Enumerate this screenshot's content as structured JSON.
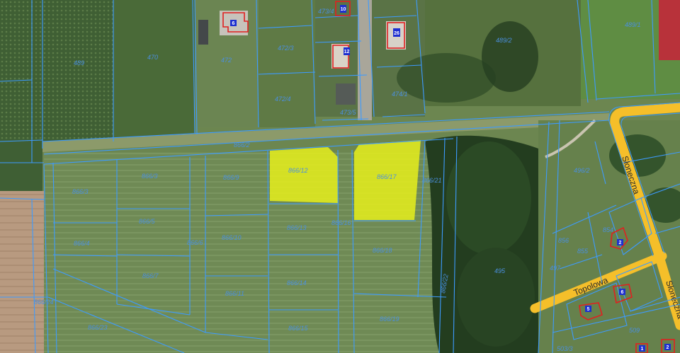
{
  "map": {
    "colors": {
      "parcel_line": "#3d9bff",
      "highlight": "#e6ee1c",
      "road": "#f5bf2a",
      "building_outline": "#e02020",
      "house_marker": "#1e2fd0",
      "parcel_label": "#4a8fe0"
    },
    "parcel_labels": {
      "p489": "489",
      "p470": "470",
      "p472": "472",
      "p472_3": "472/3",
      "p472_4": "472/4",
      "p473_4": "473/4",
      "p473_5": "473/5",
      "p474_1": "474/1",
      "p474_2": "474/2",
      "p489_2": "489/2",
      "p489_1": "489/1",
      "p866_2": "866/2",
      "p866_3a": "866/3",
      "p866_3b": "866/3",
      "p866_9": "866/9",
      "p866_12": "866/12",
      "p866_17": "866/17",
      "p866_21": "866/21",
      "p866_5": "866/5",
      "p866_4": "866/4",
      "p866_6": "866/6",
      "p866_10": "866/10",
      "p866_13": "866/13",
      "p866_16": "866/16",
      "p866_18": "866/18",
      "p866_7": "866/7",
      "p866_11": "866/11",
      "p866_14": "866/14",
      "p866_15": "866/15",
      "p866_19": "866/19",
      "p866_23": "866/23",
      "p866_22": "866/22",
      "p866_24": "866/24",
      "p495": "495",
      "p496_2": "496/2",
      "p854": "854",
      "p855": "855",
      "p856": "856",
      "p497": "497",
      "p503_3": "503/3",
      "p509": "509"
    },
    "streets": {
      "sloneczna_north": "Słoneczna",
      "sloneczna_south": "Słoneczna",
      "topolowa": "Topolowa"
    },
    "house_numbers": [
      "6",
      "10",
      "12",
      "26",
      "2",
      "5",
      "6",
      "1",
      "2"
    ]
  }
}
